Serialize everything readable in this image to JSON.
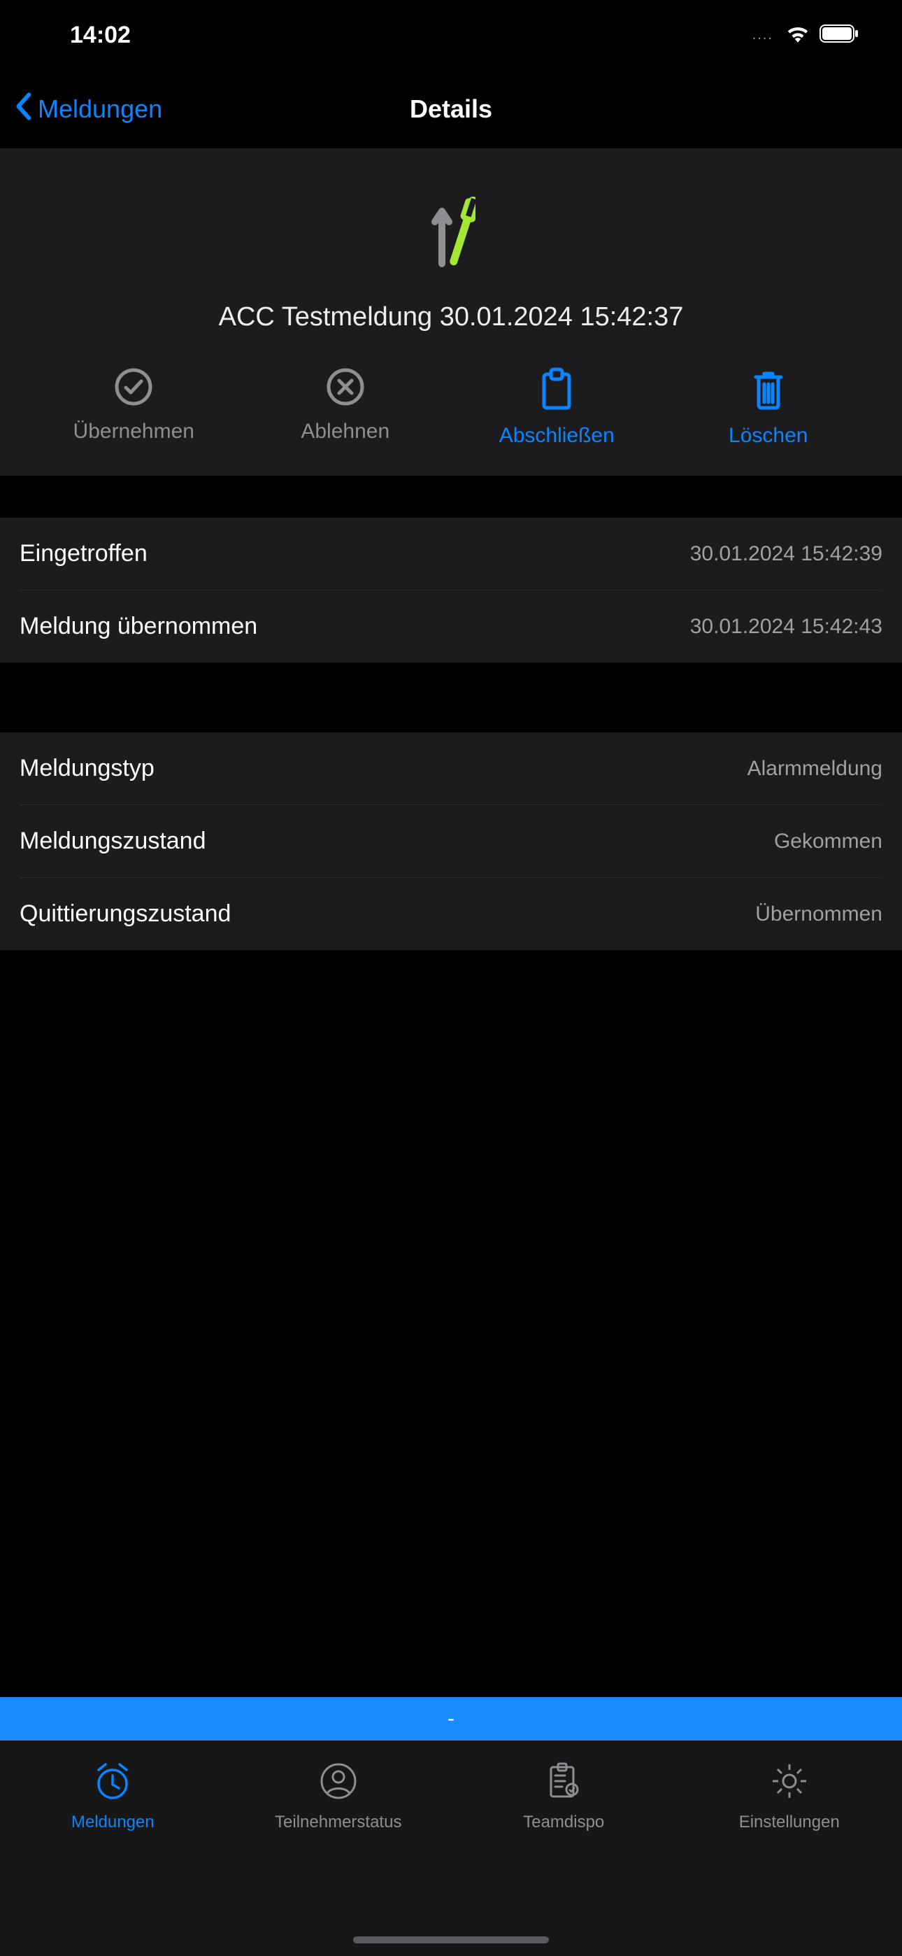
{
  "status": {
    "time": "14:02",
    "dots": "....",
    "wifi": "wifi-icon",
    "battery": "battery-icon"
  },
  "nav": {
    "back_label": "Meldungen",
    "title": "Details"
  },
  "header": {
    "title": "ACC Testmeldung 30.01.2024 15:42:37"
  },
  "actions": {
    "accept": "Übernehmen",
    "reject": "Ablehnen",
    "complete": "Abschließen",
    "delete": "Löschen"
  },
  "section1": {
    "rows": [
      {
        "label": "Eingetroffen",
        "value": "30.01.2024 15:42:39"
      },
      {
        "label": "Meldung übernommen",
        "value": "30.01.2024 15:42:43"
      }
    ]
  },
  "section2": {
    "rows": [
      {
        "label": "Meldungstyp",
        "value": "Alarmmeldung"
      },
      {
        "label": "Meldungszustand",
        "value": "Gekommen"
      },
      {
        "label": "Quittierungszustand",
        "value": "Übernommen"
      }
    ]
  },
  "banner": {
    "text": "-"
  },
  "tabs": {
    "items": [
      {
        "label": "Meldungen"
      },
      {
        "label": "Teilnehmerstatus"
      },
      {
        "label": "Teamdispo"
      },
      {
        "label": "Einstellungen"
      }
    ]
  }
}
